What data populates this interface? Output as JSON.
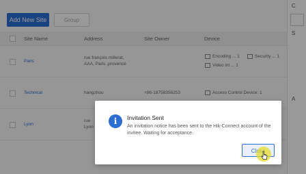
{
  "toolbar": {
    "add_label": "Add New Site",
    "group_label": "Group"
  },
  "right_strip": {
    "top": "C",
    "mid": "S",
    "box": "",
    "lower": "A"
  },
  "table": {
    "columns": [
      "Site Name",
      "Address",
      "Site Owner",
      "Device"
    ],
    "rows": [
      {
        "name": "Paris",
        "address_line1": "rue françois millerat,",
        "address_line2": "AAA, Paris ,provencé",
        "owner": "",
        "device1": "Encoding ... 1",
        "device1b": "Security ... 1",
        "device2": "Video int ... 1"
      },
      {
        "name": "Technical",
        "address_line1": "hangzhou",
        "address_line2": "",
        "owner": "+86-18758356253",
        "device1": "Access Control Device: 1",
        "device1b": "",
        "device2": ""
      },
      {
        "name": "Lyon",
        "address_line1": "rue",
        "address_line2": "Lyon",
        "owner": "",
        "device1": "",
        "device1b": "",
        "device2": ""
      }
    ]
  },
  "dialog": {
    "icon": "info-icon",
    "title": "Invitation Sent",
    "message": "An invitation notice has been sent to the Hik-Connect account of the invitee. Waiting for acceptance.",
    "close_label": "Close"
  },
  "colors": {
    "accent": "#2b6fd6",
    "cursor_highlight": "#e6de28"
  }
}
